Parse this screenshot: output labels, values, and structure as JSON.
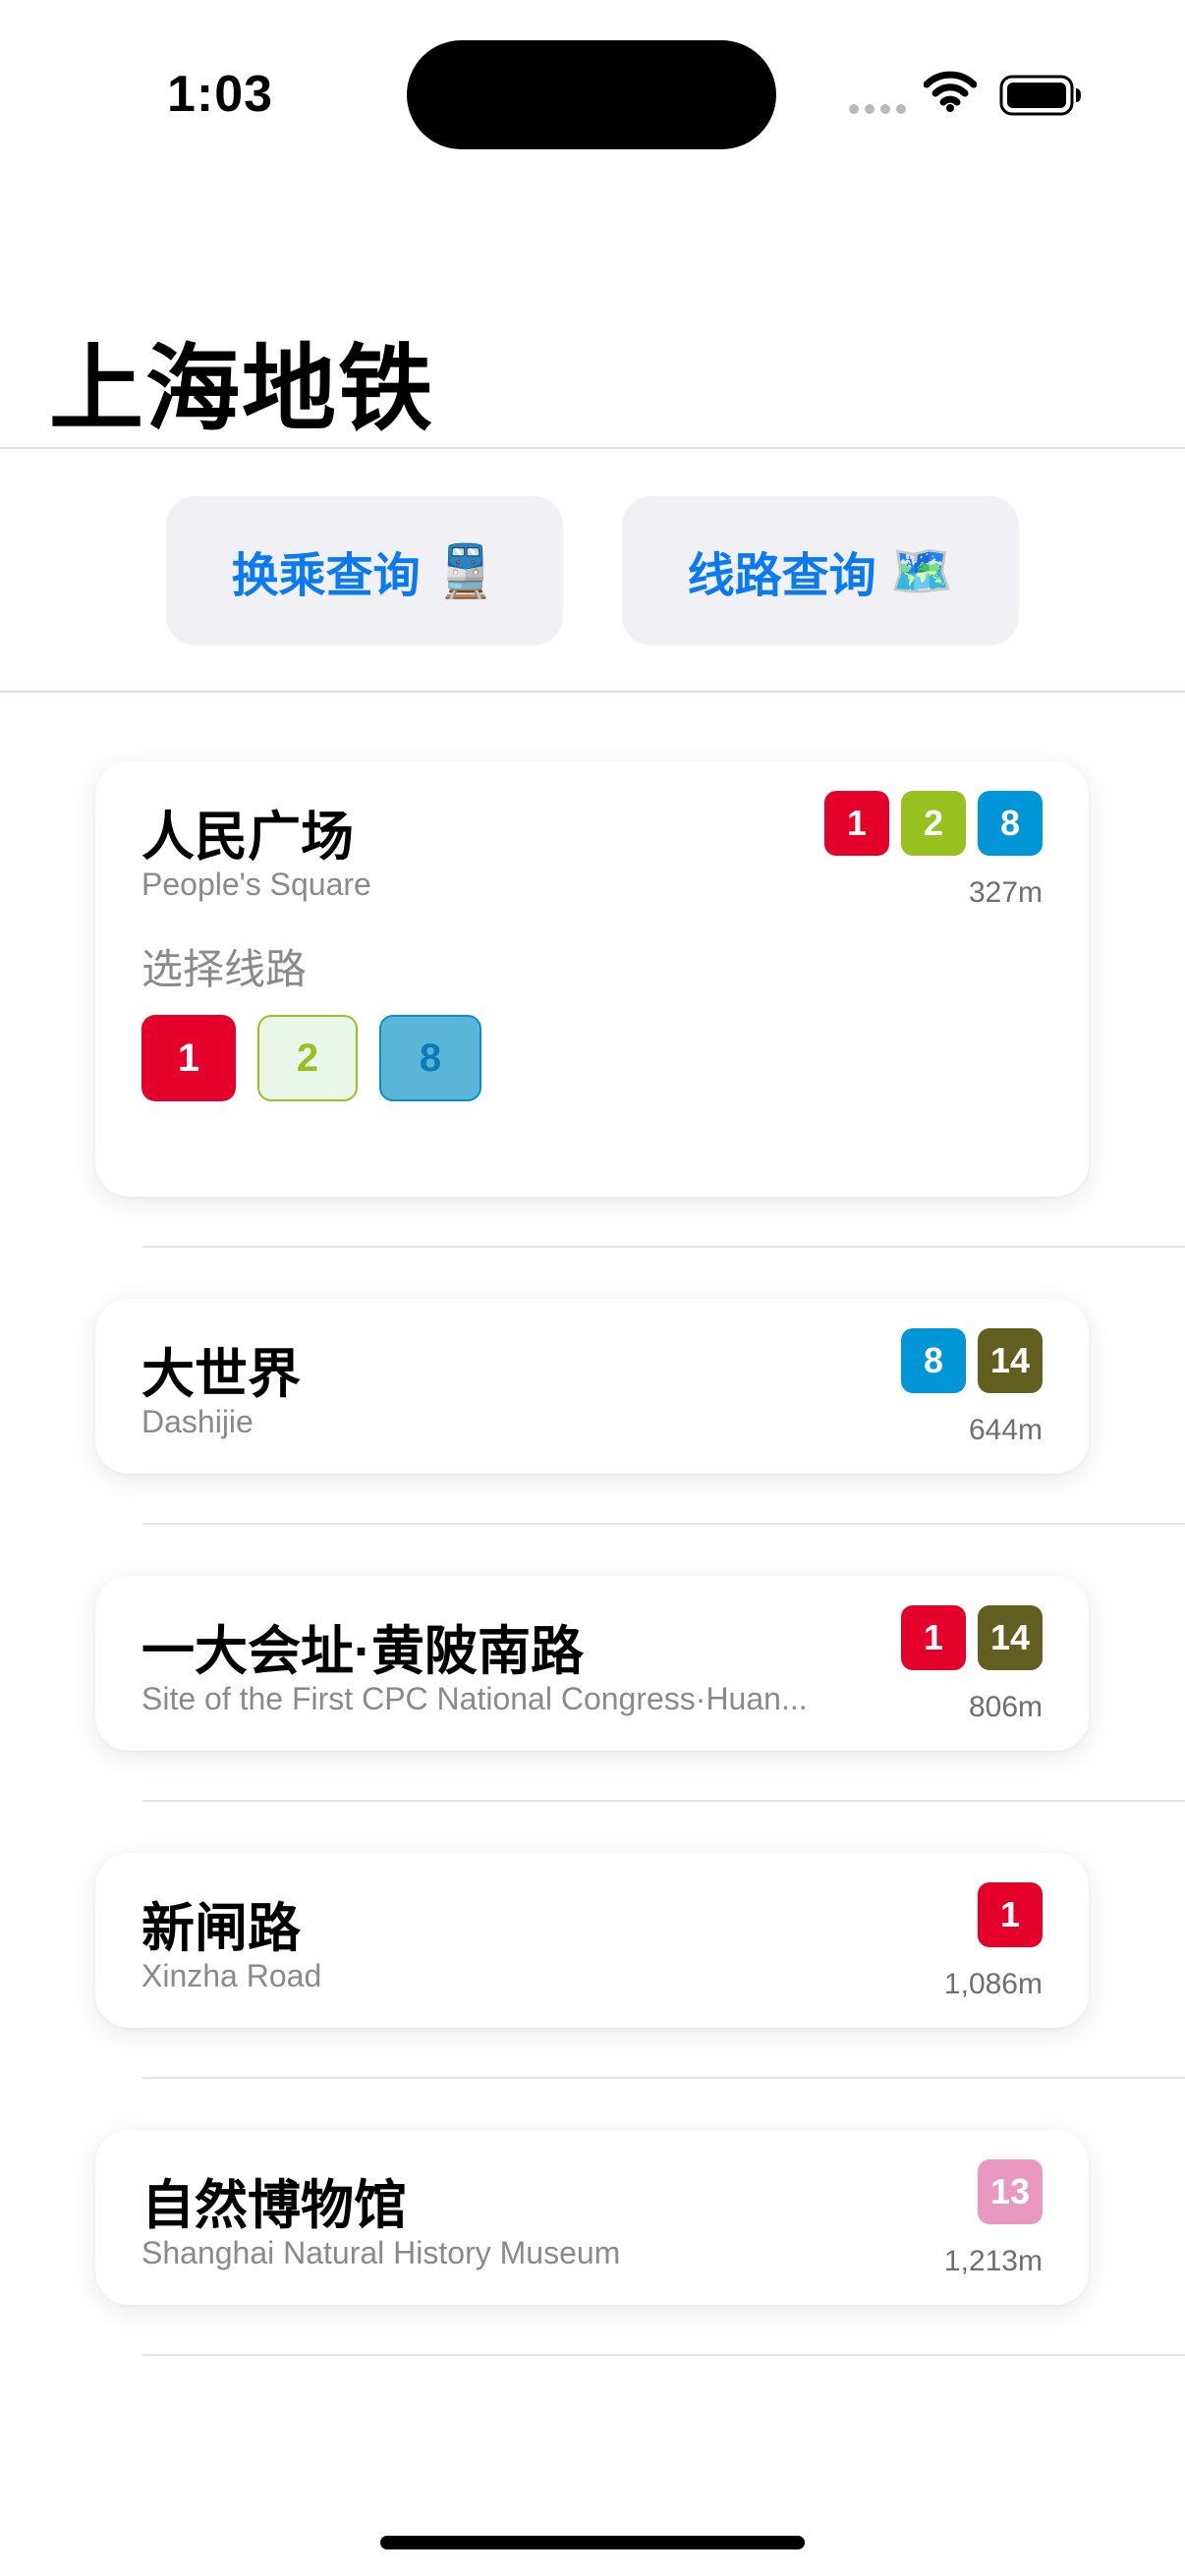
{
  "status_bar": {
    "time": "1:03"
  },
  "title": "上海地铁",
  "actions": [
    {
      "label": "换乘查询",
      "icon": "🚆"
    },
    {
      "label": "线路查询",
      "icon": "🗺️"
    }
  ],
  "line_colors": {
    "1": "#e4002b",
    "2": "#97c11f",
    "8": "#0096d8",
    "13": "#e999c0",
    "14": "#626020"
  },
  "stations": [
    {
      "name": "人民广场",
      "name_en": "People's Square",
      "lines": [
        "1",
        "2",
        "8"
      ],
      "distance": "327m",
      "select_label": "选择线路",
      "line_options": [
        "1",
        "2",
        "8"
      ]
    },
    {
      "name": "大世界",
      "name_en": "Dashijie",
      "lines": [
        "8",
        "14"
      ],
      "distance": "644m"
    },
    {
      "name": "一大会址·黄陂南路",
      "name_en": "Site of the First CPC National Congress·Huan...",
      "lines": [
        "1",
        "14"
      ],
      "distance": "806m"
    },
    {
      "name": "新闸路",
      "name_en": "Xinzha Road",
      "lines": [
        "1"
      ],
      "distance": "1,086m"
    },
    {
      "name": "自然博物馆",
      "name_en": "Shanghai Natural History Museum",
      "lines": [
        "13"
      ],
      "distance": "1,213m"
    }
  ]
}
